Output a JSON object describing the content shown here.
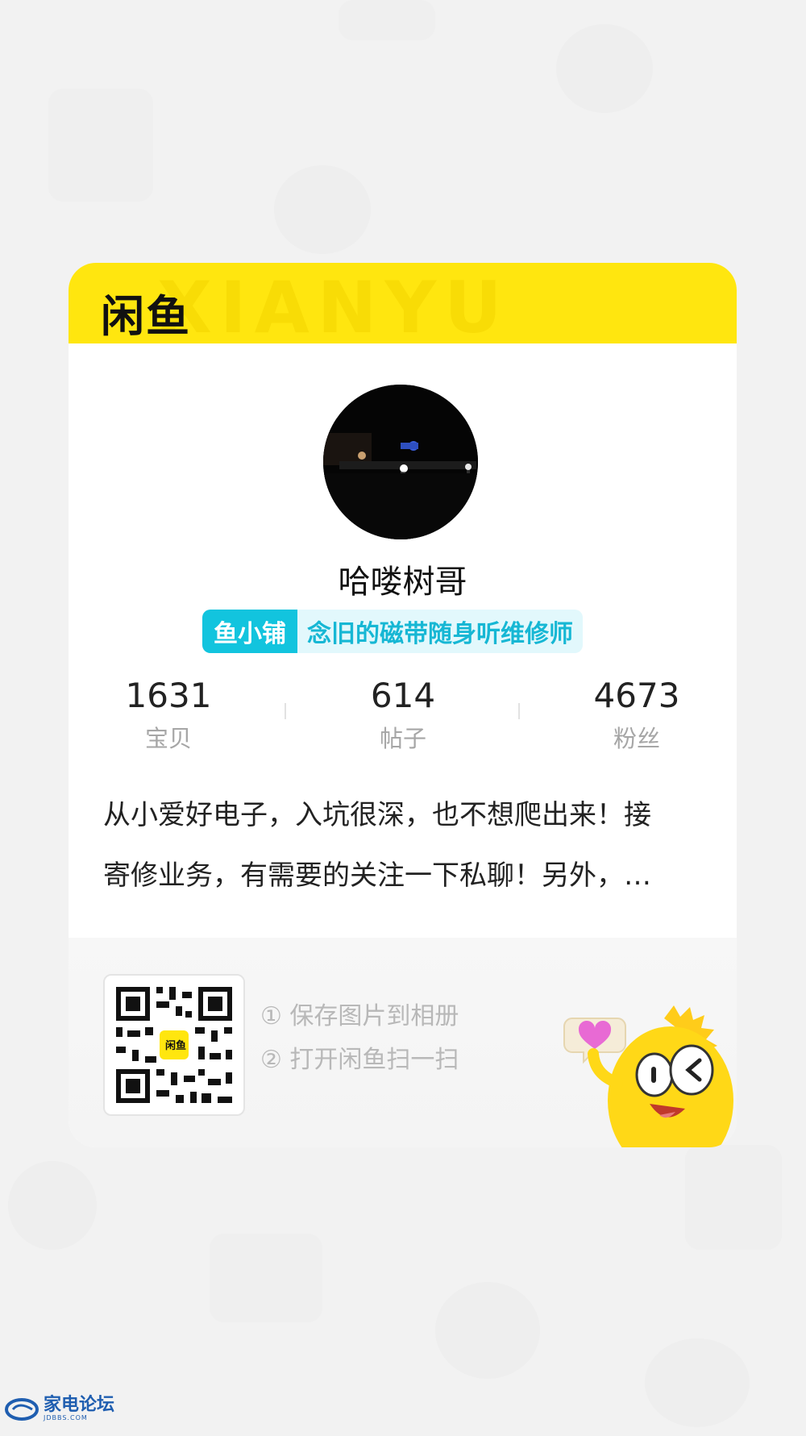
{
  "header": {
    "logo_text": "闲鱼",
    "watermark_text": "XIANYU"
  },
  "profile": {
    "username": "哈喽树哥",
    "shop_tag": "鱼小铺",
    "shop_title": "念旧的磁带随身听维修师"
  },
  "stats": [
    {
      "value": "1631",
      "label": "宝贝"
    },
    {
      "value": "614",
      "label": "帖子"
    },
    {
      "value": "4673",
      "label": "粉丝"
    }
  ],
  "bio": {
    "line1": "从小爱好电子，入坑很深，也不想爬出来！接",
    "line2": "寄修业务，有需要的关注一下私聊！另外，…"
  },
  "footer": {
    "qr_center_label": "闲鱼",
    "step1": "① 保存图片到相册",
    "step2": "② 打开闲鱼扫一扫"
  },
  "site_watermark": {
    "name": "家电论坛",
    "domain": "JDBBS.COM"
  },
  "colors": {
    "brand_yellow": "#ffe60f",
    "shop_teal": "#12c4de"
  }
}
